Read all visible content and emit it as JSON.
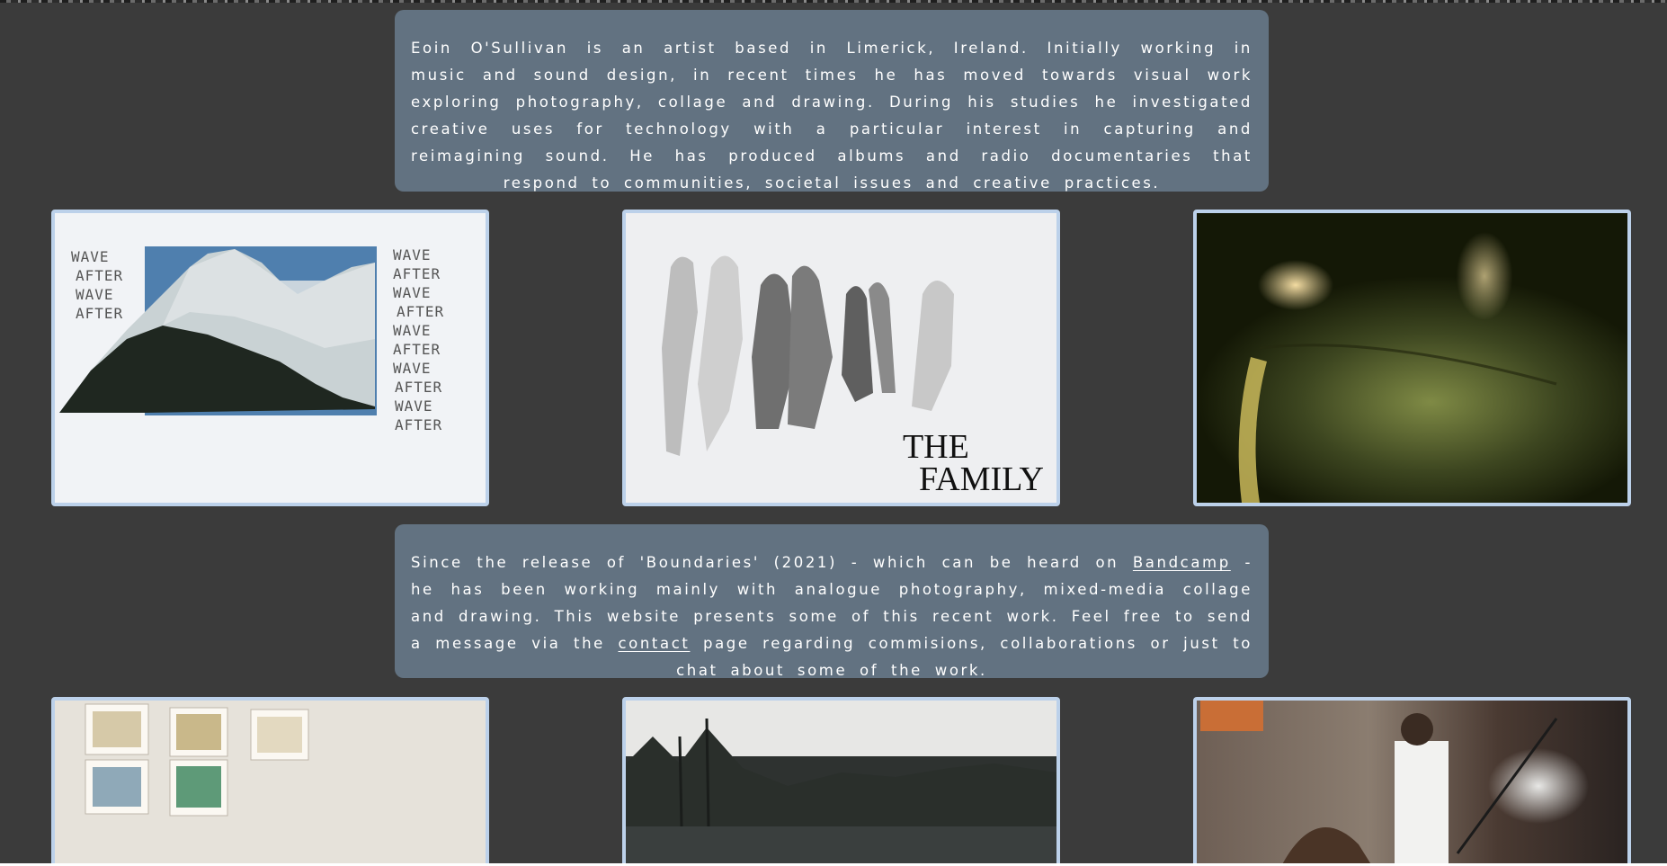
{
  "bio": {
    "text": "Eoin O'Sullivan is an artist based in Limerick, Ireland. Initially working in music and sound design, in recent times he has moved towards visual work exploring photography, collage and drawing. During his studies he investigated creative uses for technology with a particular interest in capturing and reimagining sound. He has produced albums and radio documentaries that respond to communities, societal issues and creative practices."
  },
  "intro": {
    "part1": "Since the release of 'Boundaries' (2021) - which can be heard on ",
    "bandcamp_link": "Bandcamp",
    "part2": " - he has been working mainly with analogue photography, mixed-media collage and drawing. This website presents some of this recent work. Feel free to send a message via the ",
    "contact_link": "contact",
    "part3": " page regarding commisions, collaborations or just to chat about some of the work."
  },
  "artworks": {
    "wave": {
      "left_words": [
        "WAVE",
        "AFTER",
        "WAVE",
        "AFTER"
      ],
      "right_words": [
        "WAVE",
        "AFTER",
        "WAVE",
        "AFTER",
        "WAVE",
        "AFTER",
        "WAVE",
        "AFTER",
        "WAVE",
        "AFTER"
      ]
    },
    "family": {
      "title_line1": "THE",
      "title_line2": "FAMILY"
    }
  },
  "colors": {
    "background": "#3b3b3b",
    "panel": "#627281",
    "tile_border": "#bcd1ea"
  }
}
